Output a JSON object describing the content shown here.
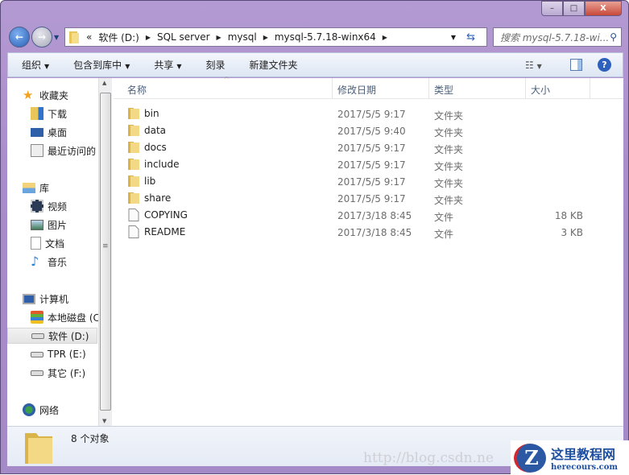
{
  "window": {
    "minimize": "–",
    "maximize": "□",
    "close": "X"
  },
  "address": {
    "overflow": "«",
    "crumbs": [
      "软件 (D:)",
      "SQL server",
      "mysql",
      "mysql-5.7.18-winx64"
    ]
  },
  "search": {
    "placeholder": "搜索 mysql-5.7.18-wi..."
  },
  "toolbar": {
    "organize": "组织",
    "include_library": "包含到库中",
    "share": "共享",
    "burn": "刻录",
    "new_folder": "新建文件夹"
  },
  "nav": {
    "favorites": "收藏夹",
    "downloads": "下载",
    "desktop": "桌面",
    "recent": "最近访问的",
    "libraries": "库",
    "videos": "视频",
    "pictures": "图片",
    "documents": "文档",
    "music": "音乐",
    "computer": "计算机",
    "local_disk": "本地磁盘 (C",
    "drive_d": "软件 (D:)",
    "drive_e": "TPR (E:)",
    "drive_f": "其它 (F:)",
    "network": "网络"
  },
  "columns": {
    "name": "名称",
    "date": "修改日期",
    "type": "类型",
    "size": "大小"
  },
  "files": [
    {
      "name": "bin",
      "date": "2017/5/5 9:17",
      "type": "文件夹",
      "size": "",
      "kind": "folder"
    },
    {
      "name": "data",
      "date": "2017/5/5 9:40",
      "type": "文件夹",
      "size": "",
      "kind": "folder"
    },
    {
      "name": "docs",
      "date": "2017/5/5 9:17",
      "type": "文件夹",
      "size": "",
      "kind": "folder"
    },
    {
      "name": "include",
      "date": "2017/5/5 9:17",
      "type": "文件夹",
      "size": "",
      "kind": "folder"
    },
    {
      "name": "lib",
      "date": "2017/5/5 9:17",
      "type": "文件夹",
      "size": "",
      "kind": "folder"
    },
    {
      "name": "share",
      "date": "2017/5/5 9:17",
      "type": "文件夹",
      "size": "",
      "kind": "folder"
    },
    {
      "name": "COPYING",
      "date": "2017/3/18 8:45",
      "type": "文件",
      "size": "18 KB",
      "kind": "file"
    },
    {
      "name": "README",
      "date": "2017/3/18 8:45",
      "type": "文件",
      "size": "3 KB",
      "kind": "file"
    }
  ],
  "status": {
    "count": "8 个对象"
  },
  "watermark": {
    "url": "http://blog.csdn.ne",
    "logo_cn": "这里教程网",
    "logo_en": "herecours.com"
  }
}
